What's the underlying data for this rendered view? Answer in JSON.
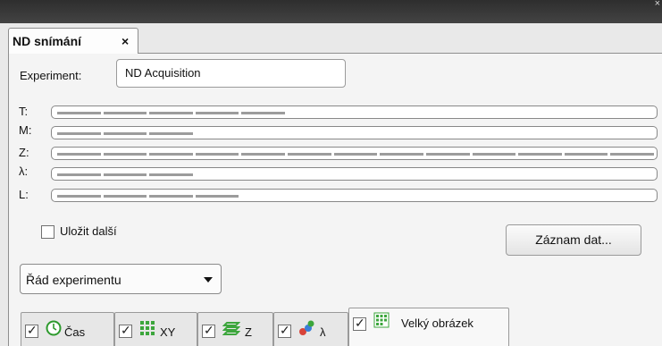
{
  "window": {
    "close_glyph": "×"
  },
  "tab": {
    "label": "ND snímání",
    "close": "×"
  },
  "experiment": {
    "label": "Experiment:",
    "value": "ND Acquisition"
  },
  "dimensions": [
    {
      "label": "T:",
      "segments": 5,
      "of": 13
    },
    {
      "label": "M:",
      "segments": 3,
      "of": 13
    },
    {
      "label": "Z:",
      "segments": 13,
      "of": 13
    },
    {
      "label": "λ:",
      "segments": 3,
      "of": 13
    },
    {
      "label": "L:",
      "segments": 4,
      "of": 13
    }
  ],
  "save_next": {
    "label": "Uložit další",
    "checked": false
  },
  "record_button": {
    "label": "Záznam dat..."
  },
  "order_select": {
    "value": "Řád experimentu"
  },
  "bottom_tabs": [
    {
      "label": "Čas",
      "icon": "clock-icon",
      "checked": true,
      "active": false
    },
    {
      "label": "XY",
      "icon": "grid-icon",
      "checked": true,
      "active": false
    },
    {
      "label": "Z",
      "icon": "z-stack-icon",
      "checked": true,
      "active": false
    },
    {
      "label": "λ",
      "icon": "wavelength-icon",
      "checked": true,
      "active": false
    },
    {
      "label": "Velký obrázek",
      "icon": "large-image-icon",
      "checked": true,
      "active": true
    }
  ],
  "colors": {
    "accent_green": "#3ca63c",
    "border": "#8e8e8e"
  }
}
